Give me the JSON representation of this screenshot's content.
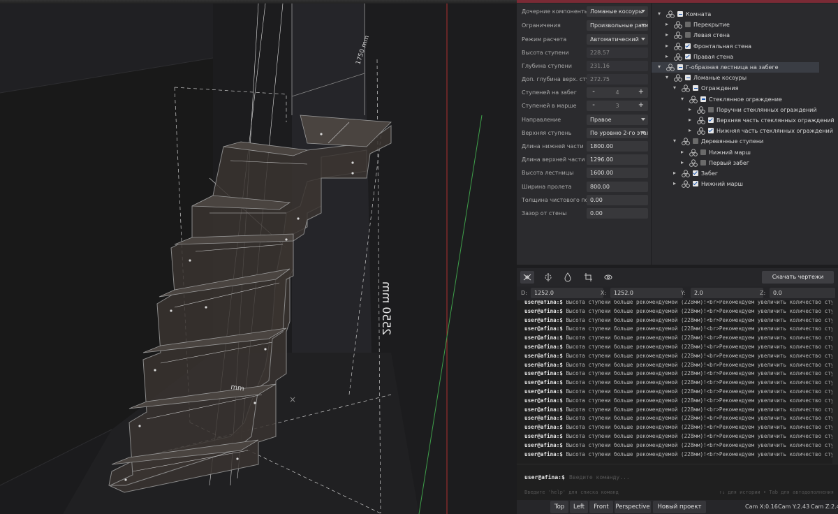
{
  "properties": [
    {
      "label": "Дочерние компоненты",
      "kind": "select",
      "value": "Ломаные косоуры"
    },
    {
      "label": "Ограничения",
      "kind": "select",
      "value": "Произвольные размеры"
    },
    {
      "label": "Режим расчета",
      "kind": "select",
      "value": "Автоматический"
    },
    {
      "label": "Высота ступени",
      "kind": "readonly",
      "value": "228.57"
    },
    {
      "label": "Глубина ступени",
      "kind": "readonly",
      "value": "231.16"
    },
    {
      "label": "Доп. глубина верх. сту...",
      "kind": "readonly",
      "value": "272.75"
    },
    {
      "label": "Ступеней на забег",
      "kind": "stepper",
      "value": "4"
    },
    {
      "label": "Ступеней в марше",
      "kind": "stepper",
      "value": "3"
    },
    {
      "label": "Направление",
      "kind": "select",
      "value": "Правое"
    },
    {
      "label": "Верхняя ступень",
      "kind": "select",
      "value": "По уровню 2-го этажа"
    },
    {
      "label": "Длина нижней части",
      "kind": "input",
      "value": "1800.00"
    },
    {
      "label": "Длина верхней части",
      "kind": "input",
      "value": "1296.00"
    },
    {
      "label": "Высота лестницы",
      "kind": "input",
      "value": "1600.00"
    },
    {
      "label": "Ширина пролета",
      "kind": "input",
      "value": "800.00"
    },
    {
      "label": "Толщина чистового по...",
      "kind": "input",
      "value": "0.00"
    },
    {
      "label": "Зазор от стены",
      "kind": "input",
      "value": "0.00"
    }
  ],
  "tree": [
    {
      "label": "Комната",
      "level": 0,
      "arrow": "down",
      "check": "partial",
      "selected": false
    },
    {
      "label": "Перекрытие",
      "level": 1,
      "arrow": "right",
      "check": "off",
      "selected": false
    },
    {
      "label": "Левая стена",
      "level": 1,
      "arrow": "right",
      "check": "off",
      "selected": false
    },
    {
      "label": "Фронтальная стена",
      "level": 1,
      "arrow": "right",
      "check": "on",
      "selected": false
    },
    {
      "label": "Правая стена",
      "level": 1,
      "arrow": "right",
      "check": "on",
      "selected": false
    },
    {
      "label": "Г-образная лестница на забеге",
      "level": 0,
      "arrow": "down",
      "check": "partial",
      "selected": true
    },
    {
      "label": "Ломаные косоуры",
      "level": 1,
      "arrow": "down",
      "check": "partial",
      "selected": false
    },
    {
      "label": "Ограждения",
      "level": 2,
      "arrow": "down",
      "check": "partial",
      "selected": false
    },
    {
      "label": "Стеклянное ограждение",
      "level": 3,
      "arrow": "down",
      "check": "partial",
      "selected": false
    },
    {
      "label": "Поручни стеклянных ограждений",
      "level": 4,
      "arrow": "right",
      "check": "off",
      "selected": false
    },
    {
      "label": "Верхняя часть стеклянных ограждений",
      "level": 4,
      "arrow": "right",
      "check": "on",
      "selected": false
    },
    {
      "label": "Нижняя часть стеклянных ограждений",
      "level": 4,
      "arrow": "right",
      "check": "on",
      "selected": false
    },
    {
      "label": "Деревянные ступени",
      "level": 2,
      "arrow": "down",
      "check": "off",
      "selected": false
    },
    {
      "label": "Нижний марш",
      "level": 3,
      "arrow": "right",
      "check": "off",
      "selected": false
    },
    {
      "label": "Первый забег",
      "level": 3,
      "arrow": "right",
      "check": "off",
      "selected": false
    },
    {
      "label": "Забег",
      "level": 2,
      "arrow": "right",
      "check": "on",
      "selected": false
    },
    {
      "label": "Нижний марш",
      "level": 2,
      "arrow": "right",
      "check": "on",
      "selected": false
    }
  ],
  "toolbar": {
    "tools": [
      "snap-tool-icon",
      "grid-snap-icon",
      "drop-icon",
      "crop-icon",
      "rotate-view-icon"
    ],
    "download_label": "Скачать чертежи"
  },
  "coords": {
    "d_label": "D:",
    "d_value": "1252.0",
    "x_label": "X:",
    "x_value": "1252.0",
    "y_label": "Y:",
    "y_value": "2.0",
    "z_label": "Z:",
    "z_value": "0.0"
  },
  "console": {
    "prompt": "user@afina:$",
    "lines": [
      "Высота ступени больше рекомендуемой (228мм)!<br>Рекомендуем увеличить количество ступеней",
      "Высота ступени больше рекомендуемой (228мм)!<br>Рекомендуем увеличить количество ступеней",
      "Высота ступени больше рекомендуемой (228мм)!<br>Рекомендуем увеличить количество ступеней",
      "Высота ступени больше рекомендуемой (228мм)!<br>Рекомендуем увеличить количество ступеней",
      "Высота ступени больше рекомендуемой (228мм)!<br>Рекомендуем увеличить количество ступеней",
      "Высота ступени больше рекомендуемой (228мм)!<br>Рекомендуем увеличить количество ступеней",
      "Высота ступени больше рекомендуемой (228мм)!<br>Рекомендуем увеличить количество ступеней",
      "Высота ступени больше рекомендуемой (228мм)!<br>Рекомендуем увеличить количество ступеней",
      "Высота ступени больше рекомендуемой (228мм)!<br>Рекомендуем увеличить количество ступеней",
      "Высота ступени больше рекомендуемой (228мм)!<br>Рекомендуем увеличить количество ступеней",
      "Высота ступени больше рекомендуемой (228мм)!<br>Рекомендуем увеличить количество ступеней",
      "Высота ступени больше рекомендуемой (228мм)!<br>Рекомендуем увеличить количество ступеней",
      "Высота ступени больше рекомендуемой (228мм)!<br>Рекомендуем увеличить количество ступеней",
      "Высота ступени больше рекомендуемой (228мм)!<br>Рекомендуем увеличить количество ступеней",
      "Высота ступени больше рекомендуемой (228мм)!<br>Рекомендуем увеличить количество ступеней",
      "Высота ступени больше рекомендуемой (228мм)!<br>Рекомендуем увеличить количество ступеней",
      "Высота ступени больше рекомендуемой (228мм)!<br>Рекомендуем увеличить количество ступеней",
      "Высота ступени больше рекомендуемой (228мм)!<br>Рекомендуем увеличить количество ступеней"
    ]
  },
  "command": {
    "prompt": "user@afina:$",
    "placeholder": "Введите команду...",
    "hint_left": "Введите 'help' для списка команд",
    "hint_right": "↑↓ для истории • Tab для автодополнения"
  },
  "viewbar": {
    "buttons": [
      "Top",
      "Left",
      "Front",
      "Perspective",
      "Новый проект"
    ],
    "cam_x": "Cam X:0.16",
    "cam_y": "Cam Y:2.43",
    "cam_z": "Cam Z:2.44"
  },
  "viewport": {
    "dim_vertical": "2550 mm",
    "dim_top": "1750 mm",
    "dim_floor": "mm"
  },
  "colors": {
    "accent_bar": "#7a2a35",
    "check_blue": "#1a56b0",
    "axis_red": "#b03030",
    "axis_green": "#3ea04a"
  }
}
